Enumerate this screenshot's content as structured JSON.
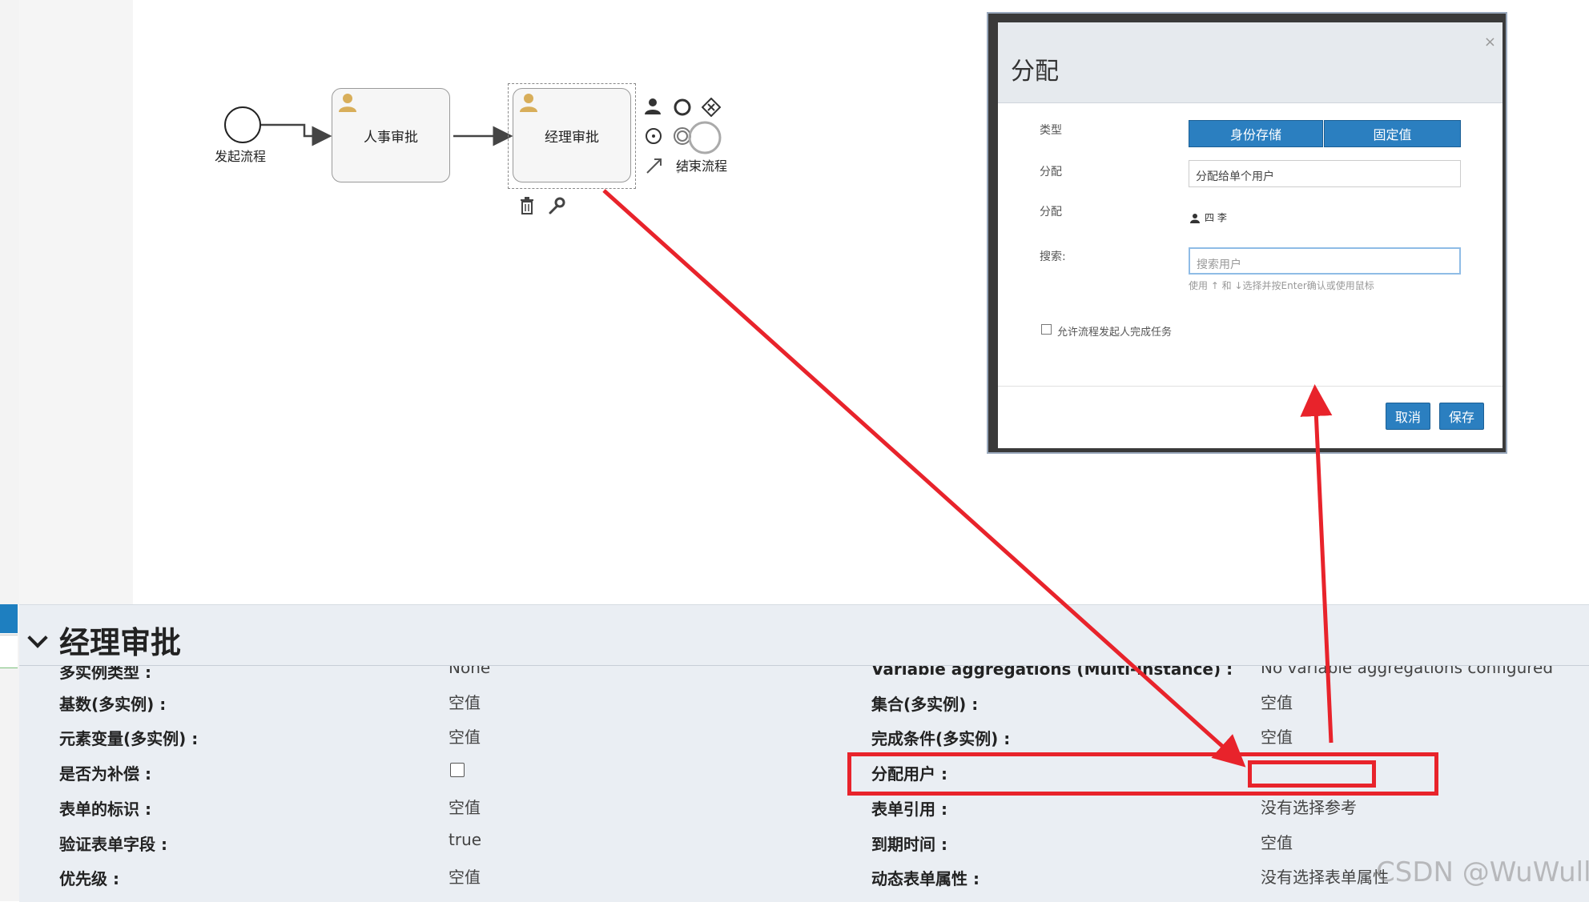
{
  "diagram": {
    "start_label": "发起流程",
    "task1_label": "人事审批",
    "task2_label": "经理审批",
    "end_label": "结束流程"
  },
  "dialog": {
    "title": "分配",
    "close": "×",
    "type_label": "类型",
    "type_options": [
      "身份存储",
      "固定值"
    ],
    "assign_label": "分配",
    "assign_select_value": "分配给单个用户",
    "assign_label2": "分配",
    "assigned_user": "四 李",
    "search_label": "搜索:",
    "search_placeholder": "搜索用户",
    "search_hint": "使用 ↑ 和 ↓选择并按Enter确认或使用鼠标",
    "allow_initiator_label": "允许流程发起人完成任务",
    "cancel_label": "取消",
    "save_label": "保存"
  },
  "panel": {
    "title": "经理审批",
    "left": [
      {
        "label": "多实例类型 :",
        "value": "None"
      },
      {
        "label": "基数(多实例) :",
        "value": "空值"
      },
      {
        "label": "元素变量(多实例) :",
        "value": "空值"
      },
      {
        "label": "是否为补偿 :",
        "value": ""
      },
      {
        "label": "表单的标识 :",
        "value": "空值"
      },
      {
        "label": "验证表单字段 :",
        "value": "true"
      },
      {
        "label": "优先级 :",
        "value": "空值"
      }
    ],
    "right": [
      {
        "label": "Variable aggregations (Multi-instance) :",
        "value": "No variable aggregations configured"
      },
      {
        "label": "集合(多实例) :",
        "value": "空值"
      },
      {
        "label": "完成条件(多实例) :",
        "value": "空值"
      },
      {
        "label": "分配用户 :",
        "value": ""
      },
      {
        "label": "表单引用 :",
        "value": "没有选择参考"
      },
      {
        "label": "到期时间 :",
        "value": "空值"
      },
      {
        "label": "动态表单属性 :",
        "value": "没有选择表单属性"
      }
    ]
  },
  "watermark": "CSDN @WuWull",
  "colors": {
    "accent": "#2b7fc0",
    "annotation": "#e8232b"
  }
}
